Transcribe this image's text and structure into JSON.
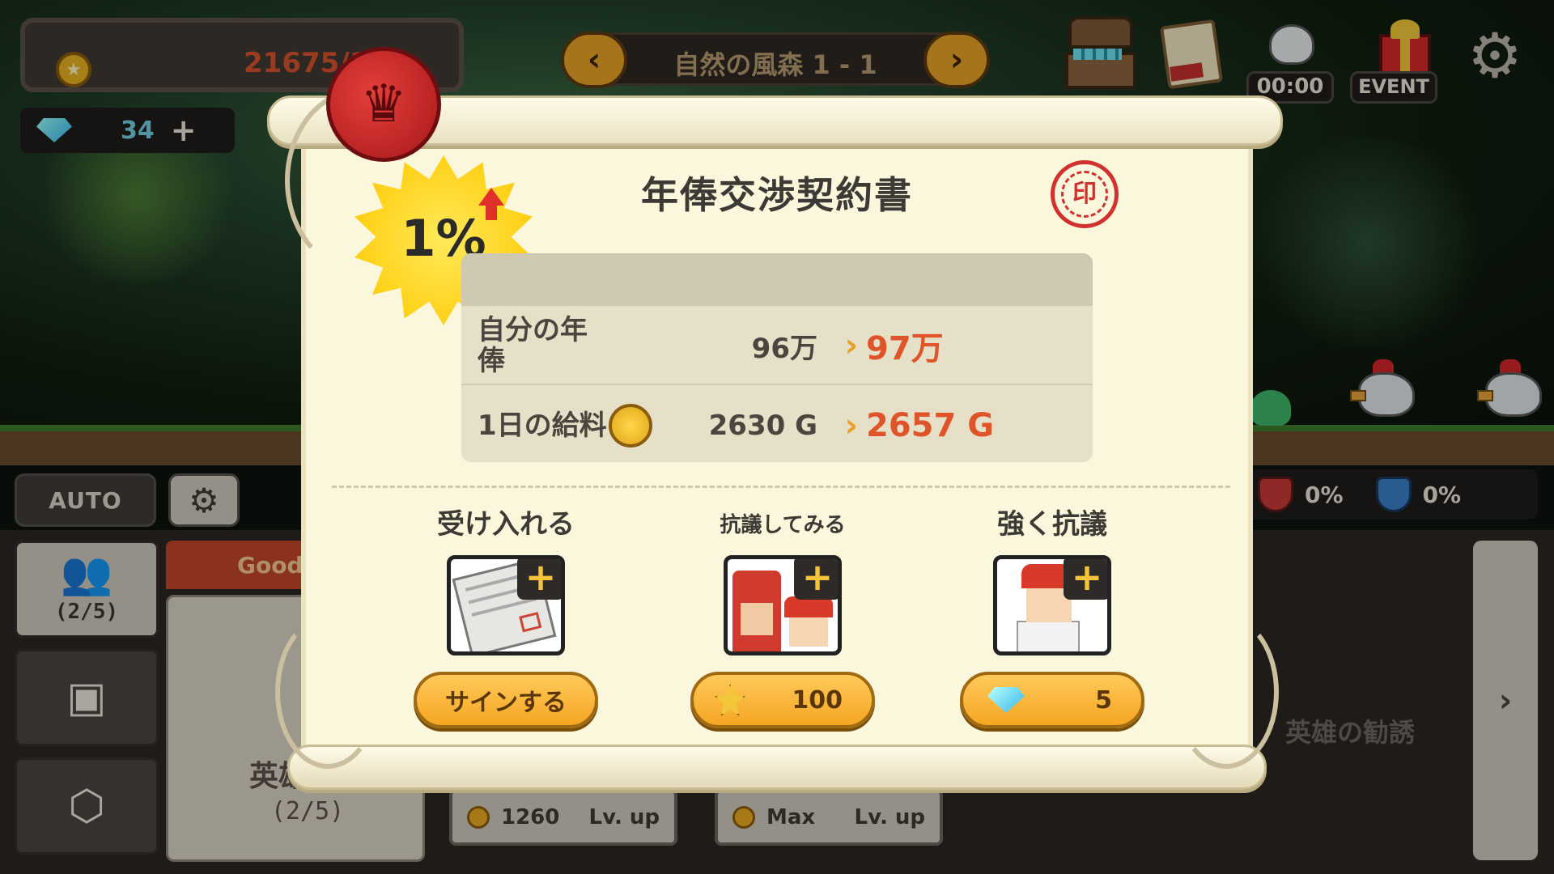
{
  "hud": {
    "gold": "21675/11",
    "gems": "34",
    "gem_plus": "+"
  },
  "stage": {
    "name": "自然の風森 1 - 1",
    "prev": "‹",
    "next": "›"
  },
  "top_icons": {
    "timer": "00:00",
    "event": "EVENT"
  },
  "controls": {
    "auto": "AUTO"
  },
  "status": {
    "attack_pct": "0%",
    "defense_pct": "0%"
  },
  "sidebar": {
    "party_count": "(2/5)"
  },
  "hero_card": {
    "tab": "Good",
    "label": "英雄募集",
    "count": "(2/5)"
  },
  "levelups": [
    {
      "value": "1260",
      "label": "Lv. up"
    },
    {
      "value": "Max",
      "label": "Lv. up"
    }
  ],
  "recruit_label": "英雄の勧誘",
  "modal": {
    "title": "年俸交渉契約書",
    "stamp": "印",
    "bonus": "1%",
    "rows": [
      {
        "label": "自分の年俸",
        "old": "96万",
        "new": "97万"
      },
      {
        "label": "1日の給料",
        "old": "2630 G",
        "new": "2657 G"
      }
    ],
    "options": [
      {
        "title": "受け入れる",
        "button": "サインする"
      },
      {
        "title": "抗議してみる",
        "cost": "100",
        "currency": "medal-icon"
      },
      {
        "title": "強く抗議",
        "cost": "5",
        "currency": "gem-icon"
      }
    ]
  },
  "colors": {
    "accent": "#f5a623",
    "highlight": "#e0542a",
    "parchment": "#fbf7dd"
  }
}
